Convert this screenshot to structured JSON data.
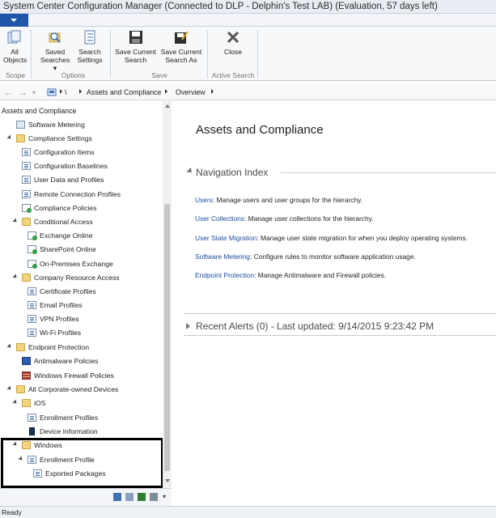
{
  "window": {
    "title": "System Center Configuration Manager (Connected to DLP - Delphin's Test LAB) (Evaluation, 57 days left)"
  },
  "ribbon": {
    "buttons": {
      "all_objects": "All\nObjects",
      "saved_searches": "Saved\nSearches ▾",
      "search_settings": "Search\nSettings",
      "save_current_search": "Save Current\nSearch",
      "save_current_search_as": "Save Current\nSearch As",
      "close": "Close"
    },
    "groups": {
      "scope": "Scope",
      "options": "Options",
      "save": "Save",
      "active_search": "Active Search"
    }
  },
  "breadcrumb": {
    "root": "\\",
    "items": [
      "Assets and Compliance",
      "Overview"
    ]
  },
  "tree": {
    "header": "Assets and Compliance",
    "nodes": [
      {
        "label": "Software Metering",
        "icon": "meter-icon"
      },
      {
        "label": "Compliance Settings",
        "icon": "folder-icon"
      },
      {
        "label": "Configuration Items",
        "icon": "config-item-icon"
      },
      {
        "label": "Configuration Baselines",
        "icon": "baseline-icon"
      },
      {
        "label": "User Data and Profiles",
        "icon": "user-data-icon"
      },
      {
        "label": "Remote Connection Profiles",
        "icon": "remote-connection-icon"
      },
      {
        "label": "Compliance Policies",
        "icon": "compliance-policy-icon"
      },
      {
        "label": "Conditional Access",
        "icon": "folder-icon"
      },
      {
        "label": "Exchange Online",
        "icon": "exchange-icon"
      },
      {
        "label": "SharePoint Online",
        "icon": "sharepoint-icon"
      },
      {
        "label": "On-Premises Exchange",
        "icon": "exchange-icon"
      },
      {
        "label": "Company Resource Access",
        "icon": "folder-icon"
      },
      {
        "label": "Certificate Profiles",
        "icon": "certificate-icon"
      },
      {
        "label": "Email Profiles",
        "icon": "email-icon"
      },
      {
        "label": "VPN Profiles",
        "icon": "vpn-icon"
      },
      {
        "label": "Wi-Fi Profiles",
        "icon": "wifi-icon"
      },
      {
        "label": "Endpoint Protection",
        "icon": "folder-icon"
      },
      {
        "label": "Antimalware Policies",
        "icon": "antimalware-icon"
      },
      {
        "label": "Windows Firewall Policies",
        "icon": "firewall-icon"
      },
      {
        "label": "All Corporate-owned Devices",
        "icon": "folder-icon"
      },
      {
        "label": "iOS",
        "icon": "folder-icon"
      },
      {
        "label": "Enrollment Profiles",
        "icon": "enrollment-icon"
      },
      {
        "label": "Device Information",
        "icon": "phone-icon"
      },
      {
        "label": "Windows",
        "icon": "folder-icon"
      },
      {
        "label": "Enrollment Profile",
        "icon": "enrollment-icon"
      },
      {
        "label": "Exported Packages",
        "icon": "package-icon"
      }
    ]
  },
  "content": {
    "title": "Assets and Compliance",
    "nav_index_title": "Navigation Index",
    "nav_items": [
      {
        "link": "Users:",
        "text": " Manage users and user groups for the hierarchy."
      },
      {
        "link": "User Collections:",
        "text": " Manage user collections for the hierarchy."
      },
      {
        "link": "User State Migration:",
        "text": " Manage user state migration for when you deploy operating systems."
      },
      {
        "link": "Software Metering:",
        "text": " Configure rules to monitor software application usage."
      },
      {
        "link": "Endpoint Protection:",
        "text": " Manage Antimalware and Firewall policies."
      }
    ],
    "recent_alerts": "Recent Alerts (0) - Last updated: 9/14/2015 9:23:42 PM"
  },
  "status": {
    "text": "Ready"
  }
}
